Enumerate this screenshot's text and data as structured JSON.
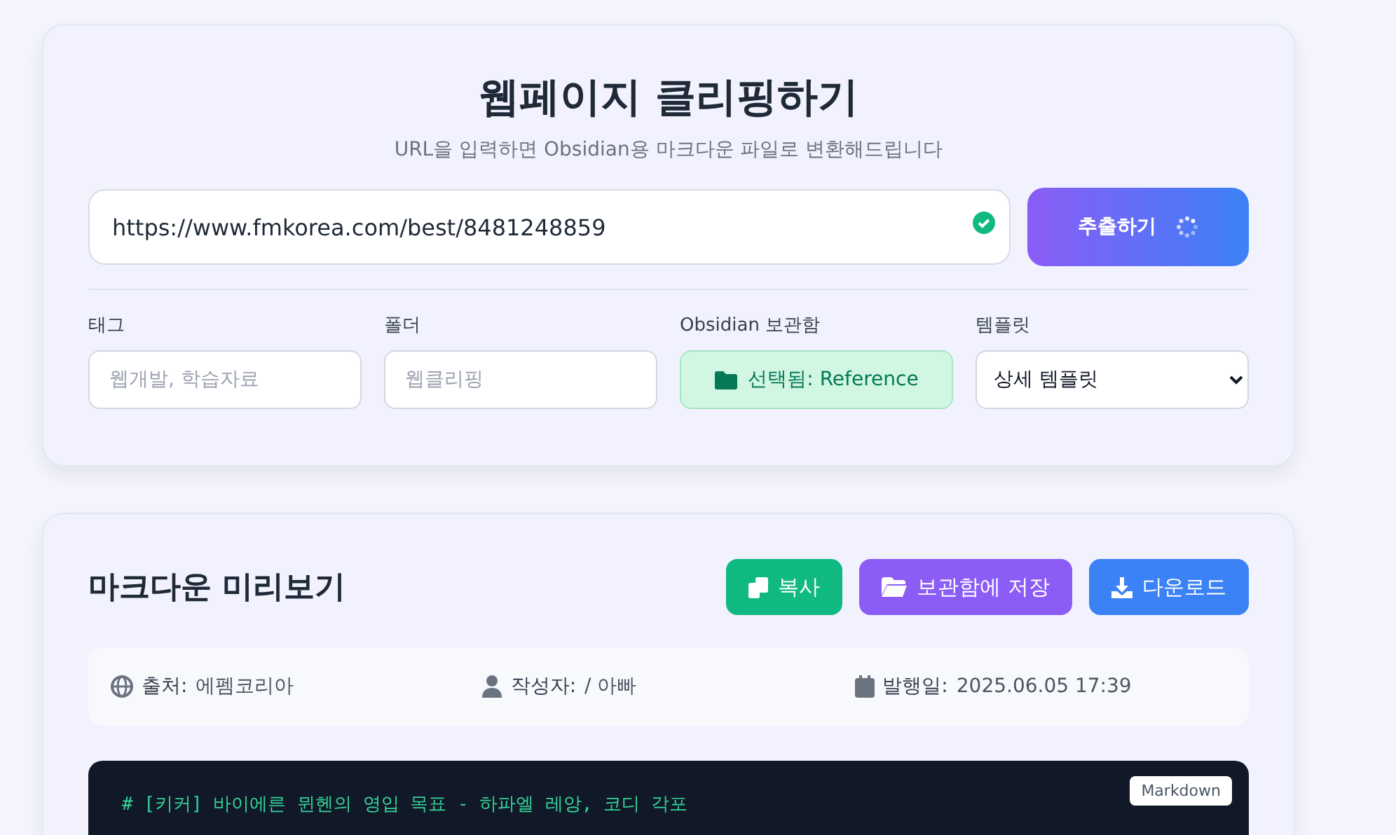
{
  "clipper": {
    "title": "웹페이지 클리핑하기",
    "subtitle": "URL을 입력하면 Obsidian용 마크다운 파일로 변환해드립니다",
    "url": {
      "value": "https://www.fmkorea.com/best/8481248859",
      "valid": true
    },
    "extract_button": {
      "label": "추출하기",
      "loading": true
    },
    "fields": [
      {
        "kind": "input",
        "label": "태그",
        "placeholder": "웹개발, 학습자료"
      },
      {
        "kind": "input",
        "label": "폴더",
        "placeholder": "웹클리핑"
      },
      {
        "kind": "vault",
        "label": "Obsidian 보관함",
        "value": "선택됨: Reference"
      },
      {
        "kind": "select",
        "label": "템플릿",
        "value": "상세 템플릿"
      }
    ]
  },
  "preview": {
    "title": "마크다운 미리보기",
    "buttons": [
      {
        "kind": "copy",
        "label": "복사",
        "color": "#10b981"
      },
      {
        "kind": "save",
        "label": "보관함에 저장",
        "color": "#8b5cf6"
      },
      {
        "kind": "download",
        "label": "다운로드",
        "color": "#3b82f6"
      }
    ],
    "meta": [
      {
        "kind": "source",
        "label": "출처:",
        "value": "에펨코리아"
      },
      {
        "kind": "author",
        "label": "작성자:",
        "value": "/ 아빠"
      },
      {
        "kind": "date",
        "label": "발행일:",
        "value": "2025.06.05 17:39"
      }
    ],
    "code": {
      "badge": "Markdown",
      "lines": [
        "# [키커] 바이에른 뮌헨의 영입 목표 - 하파엘 레앙, 코디 각포"
      ]
    }
  }
}
